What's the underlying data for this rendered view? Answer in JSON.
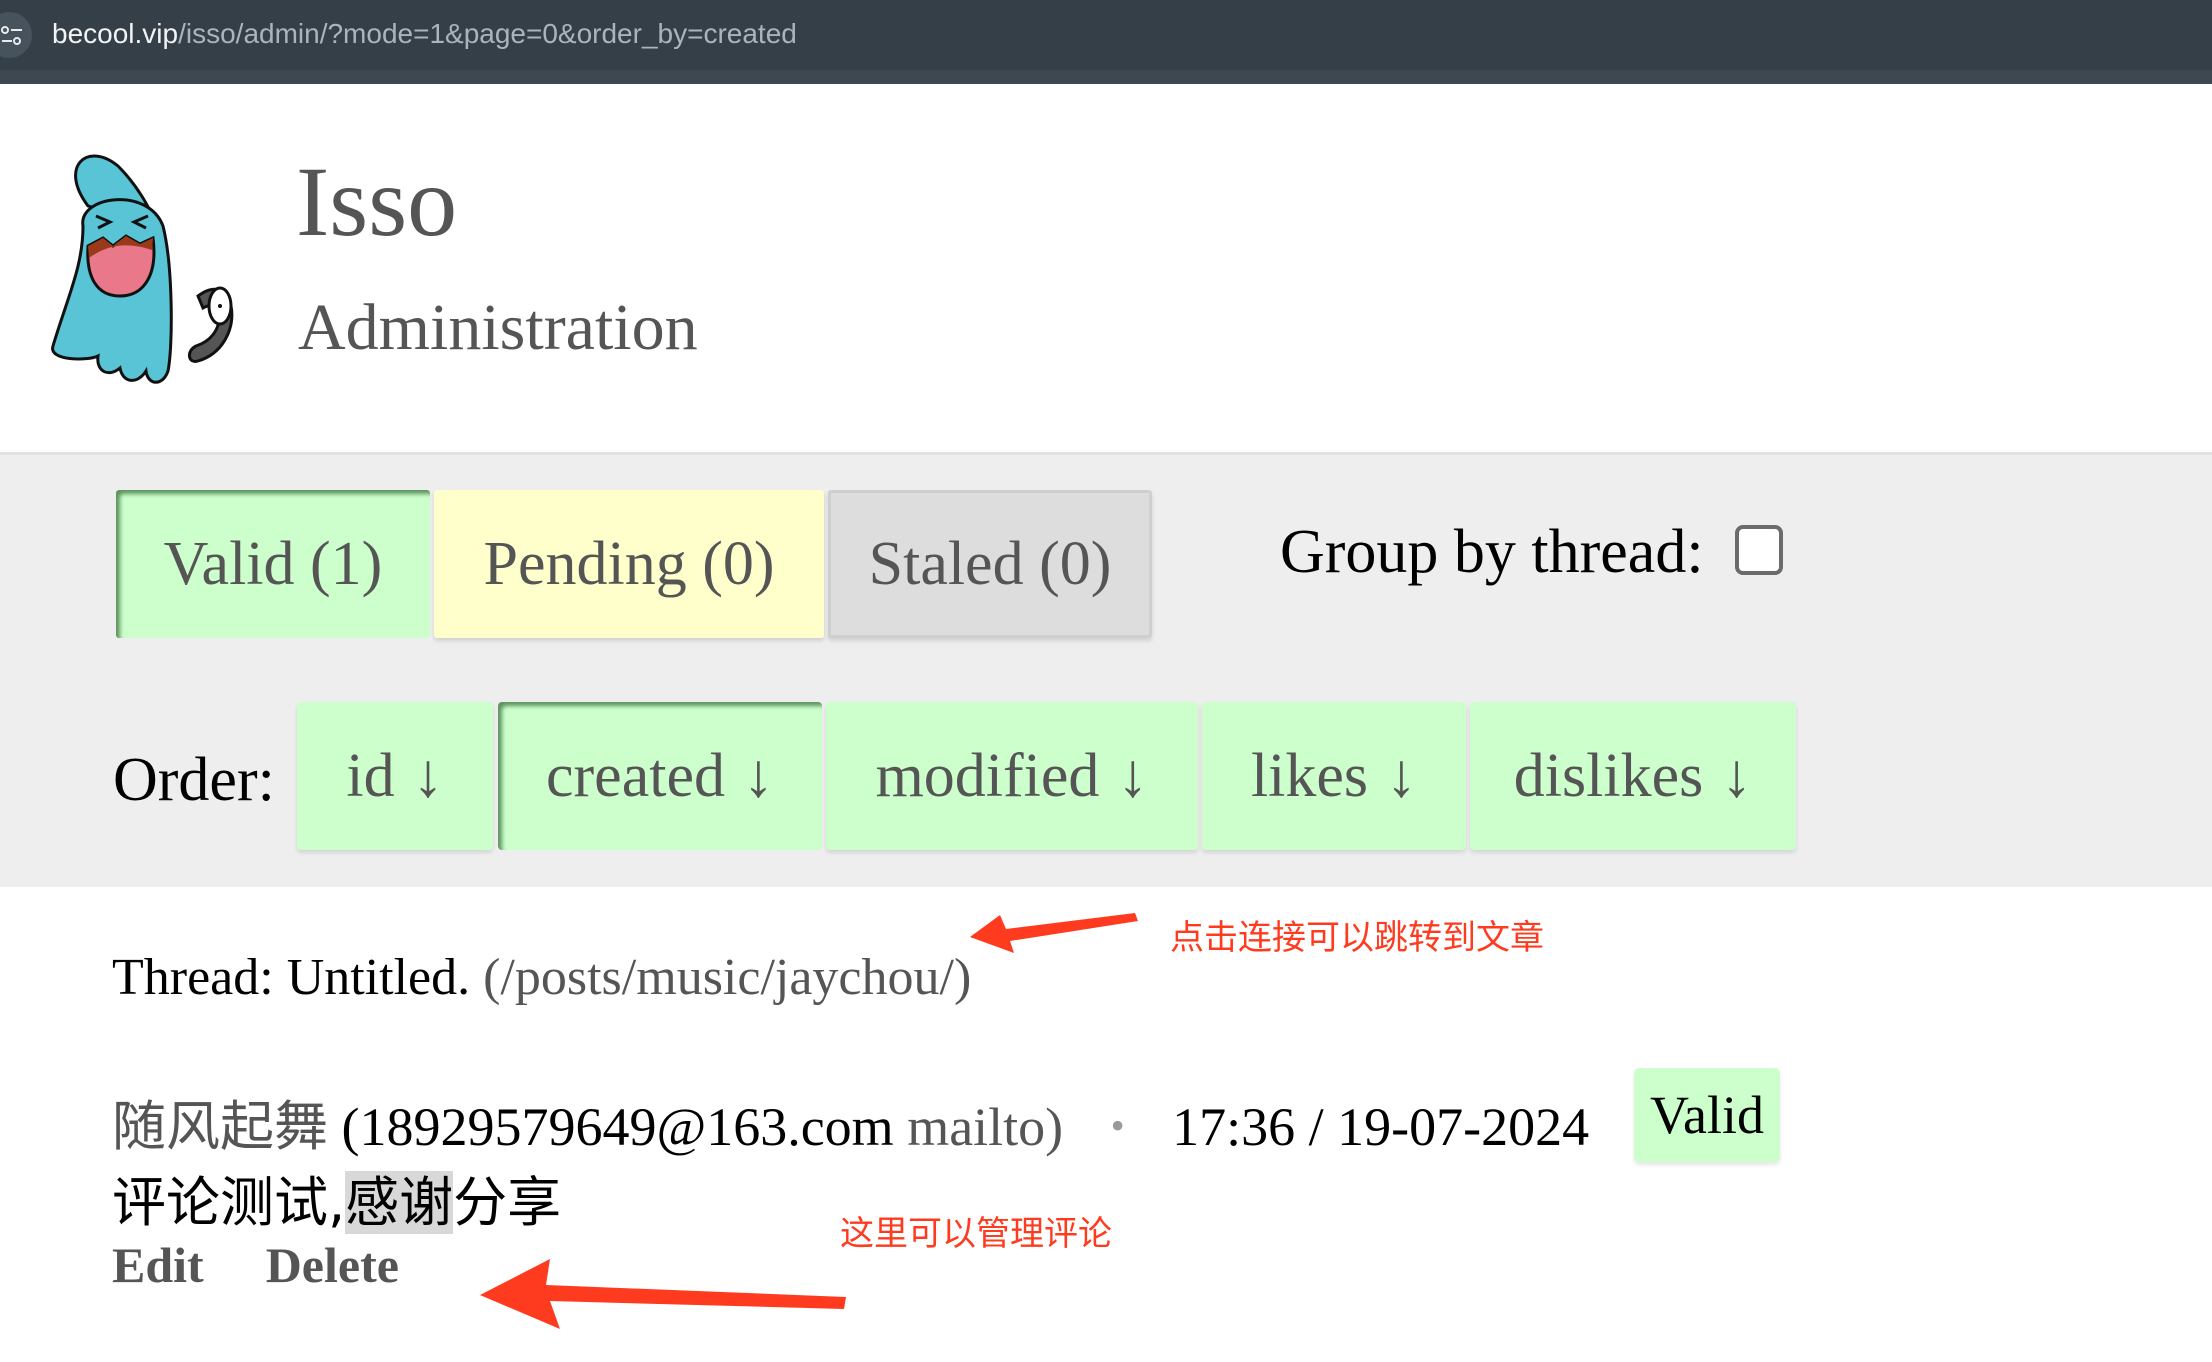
{
  "browser": {
    "url_host": "becool.vip",
    "url_path": "/isso/admin/?mode=1&page=0&order_by=created",
    "site_info_icon": "tune-icon"
  },
  "header": {
    "title": "Isso",
    "subtitle": "Administration",
    "logo": "wooper-mascot-logo"
  },
  "modes": [
    {
      "label": "Valid (1)",
      "active": true,
      "color": "#ccffcc"
    },
    {
      "label": "Pending (0)",
      "active": false,
      "color": "#ffffcc"
    },
    {
      "label": "Staled (0)",
      "active": false,
      "color": "#dddddd"
    }
  ],
  "group_by_thread": {
    "label": "Group by thread:",
    "checked": false
  },
  "order": {
    "label": "Order:",
    "arrow": "↓",
    "options": [
      {
        "label": "id",
        "active": false
      },
      {
        "label": "created",
        "active": true
      },
      {
        "label": "modified",
        "active": false
      },
      {
        "label": "likes",
        "active": false
      },
      {
        "label": "dislikes",
        "active": false
      }
    ]
  },
  "thread": {
    "prefix": "Thread: Untitled.",
    "link": "(/posts/music/jaychou/)"
  },
  "comment": {
    "author": "随风起舞",
    "email": "(18929579649@163.com",
    "mailto": "mailto)",
    "separator": "•",
    "datetime": "17:36 / 19-07-2024",
    "status": "Valid",
    "body_before": "评论测试,",
    "body_highlight": "感谢",
    "body_after": "分享",
    "edit_label": "Edit",
    "delete_label": "Delete"
  },
  "annotations": {
    "thread_note": "点击连接可以跳转到文章",
    "manage_note": "这里可以管理评论",
    "color": "#ff3b1f"
  }
}
